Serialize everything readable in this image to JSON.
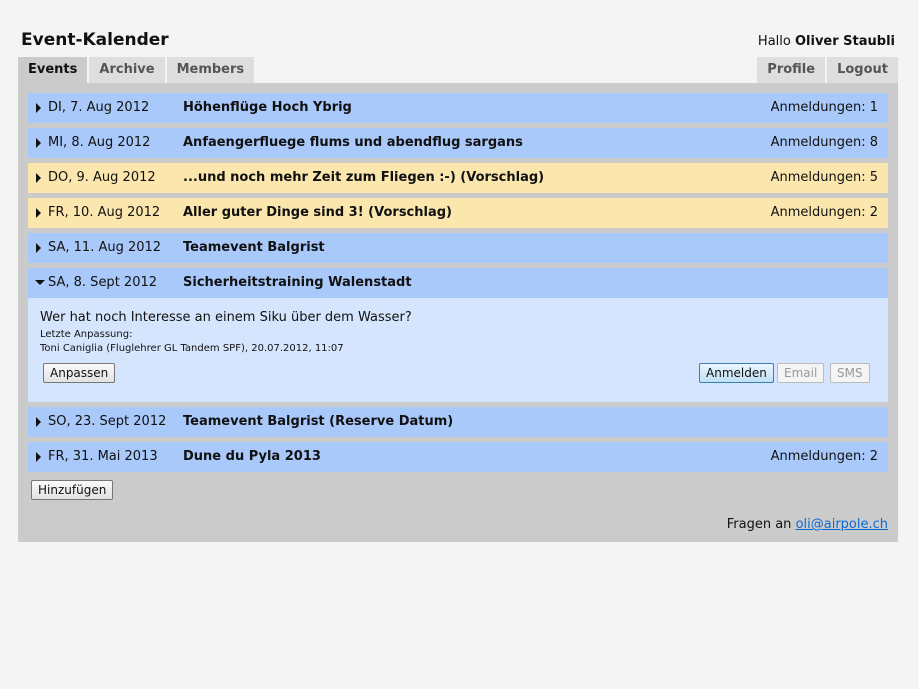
{
  "header": {
    "title": "Event-Kalender",
    "greeting_prefix": "Hallo",
    "user_name": "Oliver Staubli"
  },
  "tabs": {
    "left": [
      {
        "label": "Events",
        "active": true
      },
      {
        "label": "Archive",
        "active": false
      },
      {
        "label": "Members",
        "active": false
      }
    ],
    "right": [
      {
        "label": "Profile"
      },
      {
        "label": "Logout"
      }
    ]
  },
  "events": [
    {
      "date": "DI, 7. Aug 2012",
      "title": "Höhenflüge Hoch Ybrig",
      "registrations": "Anmeldungen: 1",
      "color": "#a9c9fb",
      "expanded": false
    },
    {
      "date": "MI, 8. Aug 2012",
      "title": "Anfaengerfluege flums und abendflug sargans",
      "registrations": "Anmeldungen: 8",
      "color": "#a9c9fb",
      "expanded": false
    },
    {
      "date": "DO, 9. Aug 2012",
      "title": "...und noch mehr Zeit zum Fliegen :-) (Vorschlag)",
      "registrations": "Anmeldungen: 5",
      "color": "#fbe7ae",
      "expanded": false
    },
    {
      "date": "FR, 10. Aug 2012",
      "title": "Aller guter Dinge sind 3! (Vorschlag)",
      "registrations": "Anmeldungen: 2",
      "color": "#fbe7ae",
      "expanded": false
    },
    {
      "date": "SA, 11. Aug 2012",
      "title": "Teamevent Balgrist",
      "registrations": "",
      "color": "#a9c9fb",
      "expanded": false
    },
    {
      "date": "SA, 8. Sept 2012",
      "title": "Sicherheitstraining Walenstadt",
      "registrations": "",
      "color": "#a9c9fb",
      "expanded": true
    },
    {
      "date": "SO, 23. Sept 2012",
      "title": "Teamevent Balgrist (Reserve Datum)",
      "registrations": "",
      "color": "#a9c9fb",
      "expanded": false
    },
    {
      "date": "FR, 31. Mai 2013",
      "title": "Dune du Pyla 2013",
      "registrations": "Anmeldungen: 2",
      "color": "#a9c9fb",
      "expanded": false
    }
  ],
  "details": {
    "description": "Wer hat noch Interesse an einem Siku über dem Wasser?",
    "last_modified_label": "Letzte Anpassung:",
    "last_modified_by": "Toni Caniglia (Fluglehrer GL Tandem SPF), 20.07.2012, 11:07",
    "edit_button": "Anpassen",
    "register_button": "Anmelden",
    "email_button": "Email",
    "sms_button": "SMS"
  },
  "actions": {
    "add_button": "Hinzufügen"
  },
  "footer": {
    "text": "Fragen an",
    "email": "oli@airpole.ch"
  }
}
